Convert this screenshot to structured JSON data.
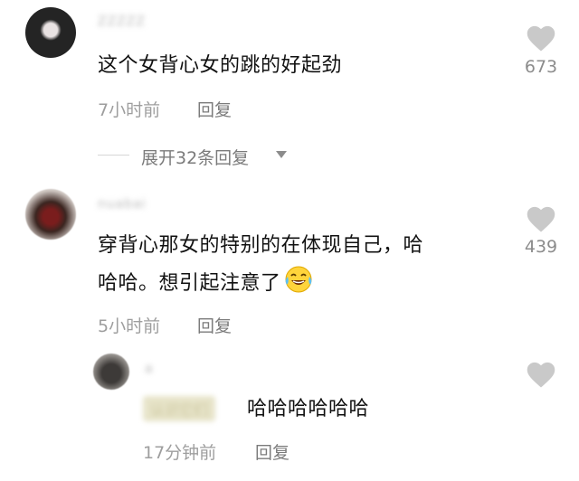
{
  "comments": [
    {
      "username": "ZZZZZ",
      "text": "这个女背心女的跳的好起劲",
      "time": "7小时前",
      "reply_label": "回复",
      "likes": "673",
      "expand_label": "展开32条回复"
    },
    {
      "username": "nuabai",
      "text_line1": "穿背心那女的特别的在体现自己，哈",
      "text_line2": "哈哈。想引起注意了",
      "emoji": "laughing-crying-emoji",
      "time": "5小时前",
      "reply_label": "回复",
      "likes": "439"
    }
  ],
  "reply": {
    "username": "a",
    "reply_to": "认识它们",
    "text": "哈哈哈哈哈哈",
    "time": "17分钟前",
    "reply_label": "回复"
  },
  "colors": {
    "heart": "#c9c9c9",
    "meta": "#9e9e9e",
    "text": "#111111"
  }
}
